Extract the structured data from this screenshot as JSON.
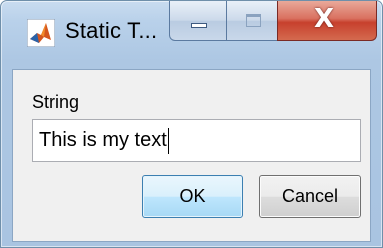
{
  "window": {
    "title": "Static T...",
    "app_icon": "matlab-logo-icon"
  },
  "caption_buttons": {
    "minimize_icon": "minimize-icon",
    "maximize_icon": "maximize-icon",
    "close_icon": "close-icon",
    "close_glyph": "X"
  },
  "dialog": {
    "field_label": "String",
    "input_value": "This is my text",
    "ok_label": "OK",
    "cancel_label": "Cancel"
  },
  "colors": {
    "frame": "#b9d1ea",
    "client_bg": "#f0f0f0",
    "close_red": "#c7402d",
    "ok_blue": "#bee6fd"
  }
}
